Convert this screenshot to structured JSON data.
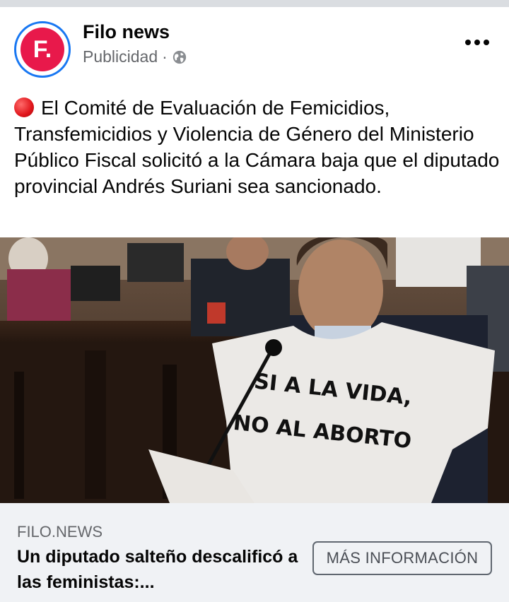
{
  "post": {
    "page_name": "Filo news",
    "avatar_letter": "F.",
    "sponsored_label": "Publicidad",
    "separator": "·",
    "body_text": "El Comité de Evaluación de Femicidios, Transfemicidios y Violencia de Género del Ministerio Público Fiscal solicitó a la Cámara baja que el diputado provincial Andrés Suriani sea sancionado."
  },
  "image": {
    "sign_line1": "SI A LA VIDA,",
    "sign_line2": "NO AL ABORTO"
  },
  "link": {
    "domain": "FILO.NEWS",
    "headline": "Un diputado salteño descalificó a las feministas:...",
    "cta_label": "MÁS INFORMACIÓN"
  },
  "colors": {
    "brand_red": "#e8194b",
    "avatar_ring": "#1877f2",
    "link_background": "#f0f2f5"
  },
  "icons": [
    "globe-icon",
    "more-options-icon",
    "red-circle-emoji"
  ]
}
